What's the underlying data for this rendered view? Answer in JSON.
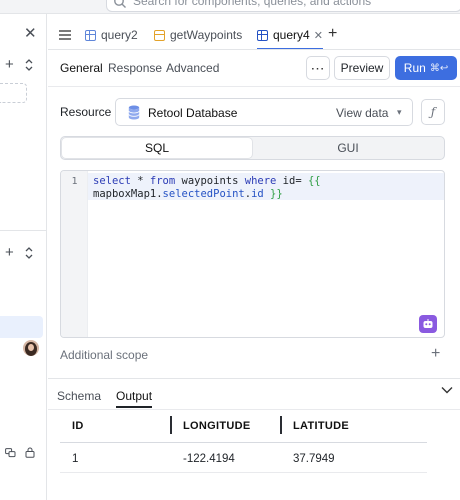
{
  "search": {
    "placeholder": "Search for components, queries, and actions"
  },
  "tabs": [
    {
      "label": "query2",
      "icon": "table-icon"
    },
    {
      "label": "getWaypoints",
      "icon": "js-icon"
    },
    {
      "label": "query4",
      "icon": "table-icon",
      "active": true
    }
  ],
  "subtabs": [
    "General",
    "Response",
    "Advanced"
  ],
  "toolbar": {
    "preview_label": "Preview",
    "run_label": "Run",
    "run_shortcut": "⌘↩"
  },
  "resource": {
    "label": "Resource",
    "selected": "Retool Database",
    "view_data_label": "View data"
  },
  "mode_toggle": {
    "sql": "SQL",
    "gui": "GUI"
  },
  "editor": {
    "line_number": "1",
    "line1": {
      "kw_select": "select",
      "star": " * ",
      "kw_from": "from",
      "table": " waypoints ",
      "kw_where": "where",
      "cond": " id= ",
      "open_brace": "{{"
    },
    "line2": {
      "obj": "mapboxMap1",
      "dot1": ".",
      "prop1": "selectedPoint",
      "dot2": ".",
      "prop2": "id",
      "close_brace": " }}"
    }
  },
  "additional_scope_label": "Additional scope",
  "bottom_panel": {
    "tabs": [
      "Schema",
      "Output"
    ],
    "active_tab": "Output"
  },
  "output_table": {
    "columns": [
      "ID",
      "LONGITUDE",
      "LATITUDE"
    ],
    "rows": [
      [
        "1",
        "-122.4194",
        "37.7949"
      ]
    ]
  },
  "colors": {
    "accent": "#3d6ee0",
    "sql_keyword": "#2b3bb5",
    "template_brace": "#2f9e44"
  }
}
